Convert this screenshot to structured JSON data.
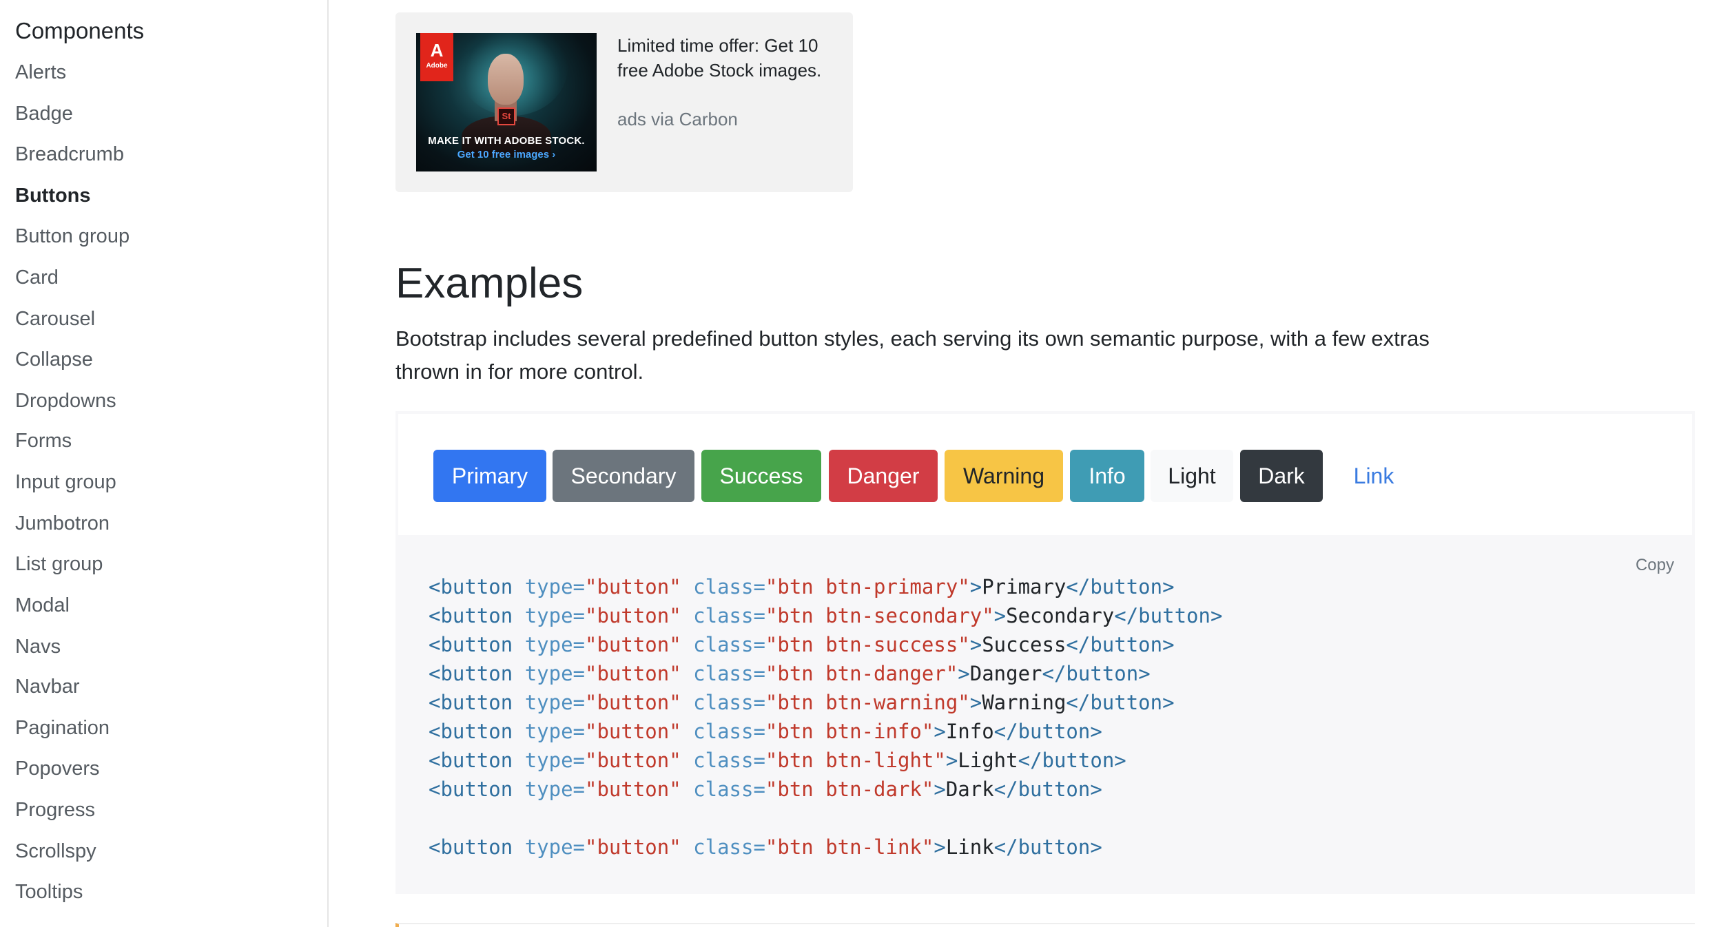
{
  "sidebar": {
    "heading": "Components",
    "items": [
      {
        "label": "Alerts",
        "active": false
      },
      {
        "label": "Badge",
        "active": false
      },
      {
        "label": "Breadcrumb",
        "active": false
      },
      {
        "label": "Buttons",
        "active": true
      },
      {
        "label": "Button group",
        "active": false
      },
      {
        "label": "Card",
        "active": false
      },
      {
        "label": "Carousel",
        "active": false
      },
      {
        "label": "Collapse",
        "active": false
      },
      {
        "label": "Dropdowns",
        "active": false
      },
      {
        "label": "Forms",
        "active": false
      },
      {
        "label": "Input group",
        "active": false
      },
      {
        "label": "Jumbotron",
        "active": false
      },
      {
        "label": "List group",
        "active": false
      },
      {
        "label": "Modal",
        "active": false
      },
      {
        "label": "Navs",
        "active": false
      },
      {
        "label": "Navbar",
        "active": false
      },
      {
        "label": "Pagination",
        "active": false
      },
      {
        "label": "Popovers",
        "active": false
      },
      {
        "label": "Progress",
        "active": false
      },
      {
        "label": "Scrollspy",
        "active": false
      },
      {
        "label": "Tooltips",
        "active": false
      }
    ]
  },
  "ad": {
    "image": {
      "brand": "Adobe",
      "badge": "St",
      "slogan": "MAKE IT WITH ADOBE STOCK.",
      "cta": "Get 10 free images ›"
    },
    "text": "Limited time offer: Get 10 free Adobe Stock images.",
    "via": "ads via Carbon"
  },
  "examples": {
    "title": "Examples",
    "lead": "Bootstrap includes several predefined button styles, each serving its own semantic purpose, with a few extras thrown in for more control.",
    "buttons": {
      "primary": "Primary",
      "secondary": "Secondary",
      "success": "Success",
      "danger": "Danger",
      "warning": "Warning",
      "info": "Info",
      "light": "Light",
      "dark": "Dark",
      "link": "Link"
    },
    "colors": {
      "primary": "#3276f1",
      "secondary": "#6c757d",
      "success": "#47a44b",
      "danger": "#d23d45",
      "warning": "#f7c545",
      "info": "#3f9cb4",
      "light": "#f8f9fa",
      "dark": "#33393f",
      "link": "#3a7be0"
    }
  },
  "code": {
    "copy_label": "Copy",
    "lines": [
      {
        "cls": "btn btn-primary",
        "text": "Primary"
      },
      {
        "cls": "btn btn-secondary",
        "text": "Secondary"
      },
      {
        "cls": "btn btn-success",
        "text": "Success"
      },
      {
        "cls": "btn btn-danger",
        "text": "Danger"
      },
      {
        "cls": "btn btn-warning",
        "text": "Warning"
      },
      {
        "cls": "btn btn-info",
        "text": "Info"
      },
      {
        "cls": "btn btn-light",
        "text": "Light"
      },
      {
        "cls": "btn btn-dark",
        "text": "Dark"
      },
      null,
      {
        "cls": "btn btn-link",
        "text": "Link"
      }
    ],
    "tag_open": "<button",
    "attr_type": "type=",
    "type_value": "\"button\"",
    "attr_class": "class=",
    "tag_close": "</button>"
  }
}
